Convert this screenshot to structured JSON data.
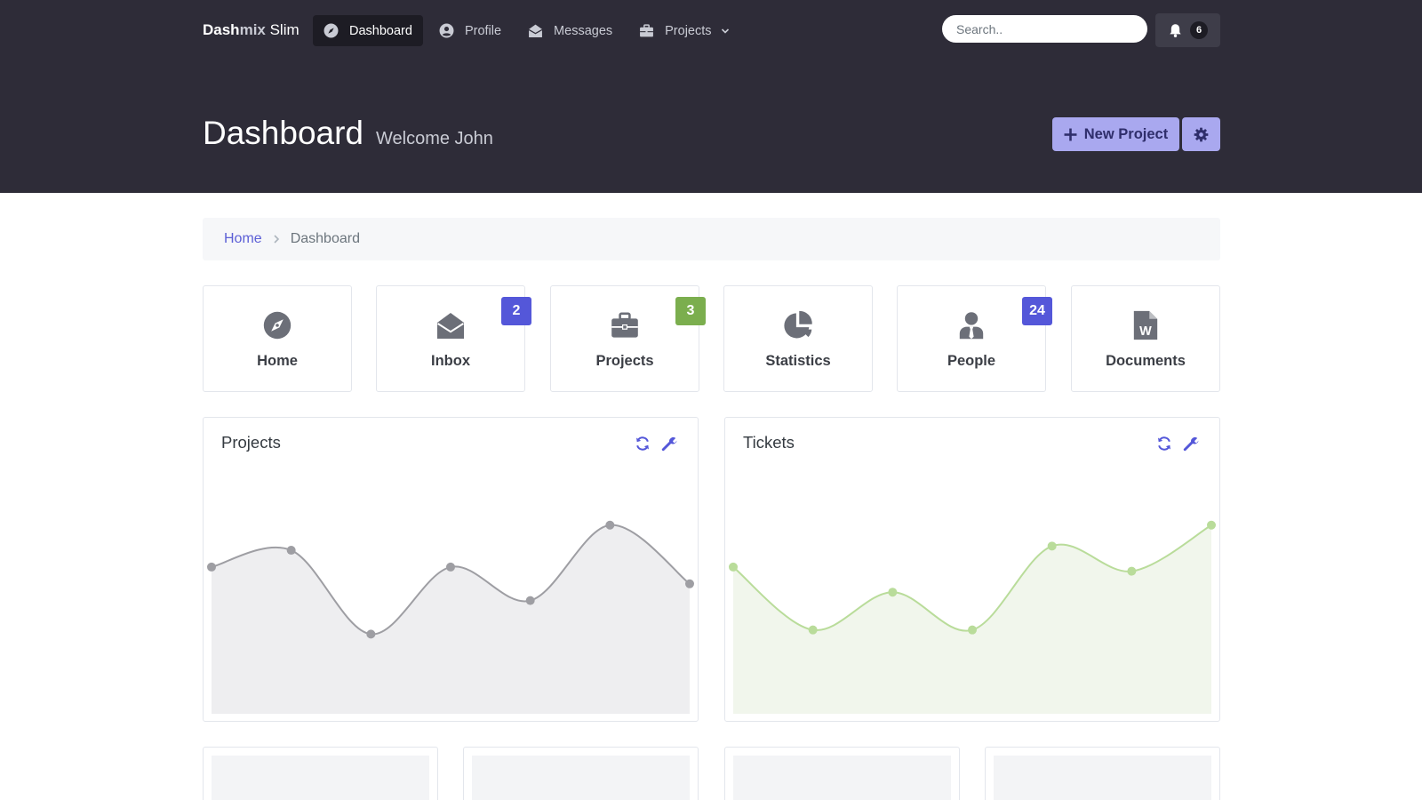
{
  "brand": {
    "part1": "Dash",
    "part2": "mix",
    "part3": " Slim"
  },
  "nav": [
    {
      "label": "Dashboard",
      "icon": "compass-icon",
      "active": true
    },
    {
      "label": "Profile",
      "icon": "user-circle-icon",
      "active": false
    },
    {
      "label": "Messages",
      "icon": "envelope-open-icon",
      "active": false
    },
    {
      "label": "Projects",
      "icon": "briefcase-icon",
      "active": false,
      "dropdown": true
    }
  ],
  "search": {
    "placeholder": "Search..",
    "value": ""
  },
  "notifications": {
    "count": "6",
    "icon": "bell-icon"
  },
  "header": {
    "title": "Dashboard",
    "subtitle": "Welcome John"
  },
  "actions": {
    "new_project": "New Project",
    "settings_icon": "cog-icon"
  },
  "breadcrumb": {
    "home": "Home",
    "current": "Dashboard"
  },
  "tiles": [
    {
      "label": "Home",
      "icon": "compass-icon",
      "badge": ""
    },
    {
      "label": "Inbox",
      "icon": "envelope-open-icon",
      "badge": "2",
      "badge_color": "#5457d9"
    },
    {
      "label": "Projects",
      "icon": "briefcase-icon",
      "badge": "3",
      "badge_color": "#7bae4e"
    },
    {
      "label": "Statistics",
      "icon": "chart-pie-icon",
      "badge": ""
    },
    {
      "label": "People",
      "icon": "user-tie-icon",
      "badge": "24",
      "badge_color": "#5457d9"
    },
    {
      "label": "Documents",
      "icon": "file-word-icon",
      "badge": ""
    }
  ],
  "colors": {
    "header_bg": "#2e2c38",
    "primary": "#5457d9",
    "primary_light": "#a9a8ef",
    "success": "#7bae4e",
    "chart_gray_line": "#9e9ea3",
    "chart_gray_fill": "#eeeef0",
    "chart_green_line": "#b9dc9a",
    "chart_green_fill": "#f1f6ec"
  },
  "chart_data": [
    {
      "type": "area",
      "title": "Projects",
      "x": [
        0,
        1,
        2,
        3,
        4,
        5,
        6
      ],
      "values": [
        35,
        39,
        19,
        35,
        27,
        45,
        31
      ],
      "ylim": [
        0,
        60
      ],
      "grid": false,
      "color": "#9e9ea3",
      "fill": "#eeeef0"
    },
    {
      "type": "area",
      "title": "Tickets",
      "x": [
        0,
        1,
        2,
        3,
        4,
        5,
        6
      ],
      "values": [
        35,
        20,
        29,
        20,
        40,
        34,
        45
      ],
      "ylim": [
        0,
        60
      ],
      "grid": false,
      "color": "#b9dc9a",
      "fill": "#f1f6ec"
    }
  ]
}
